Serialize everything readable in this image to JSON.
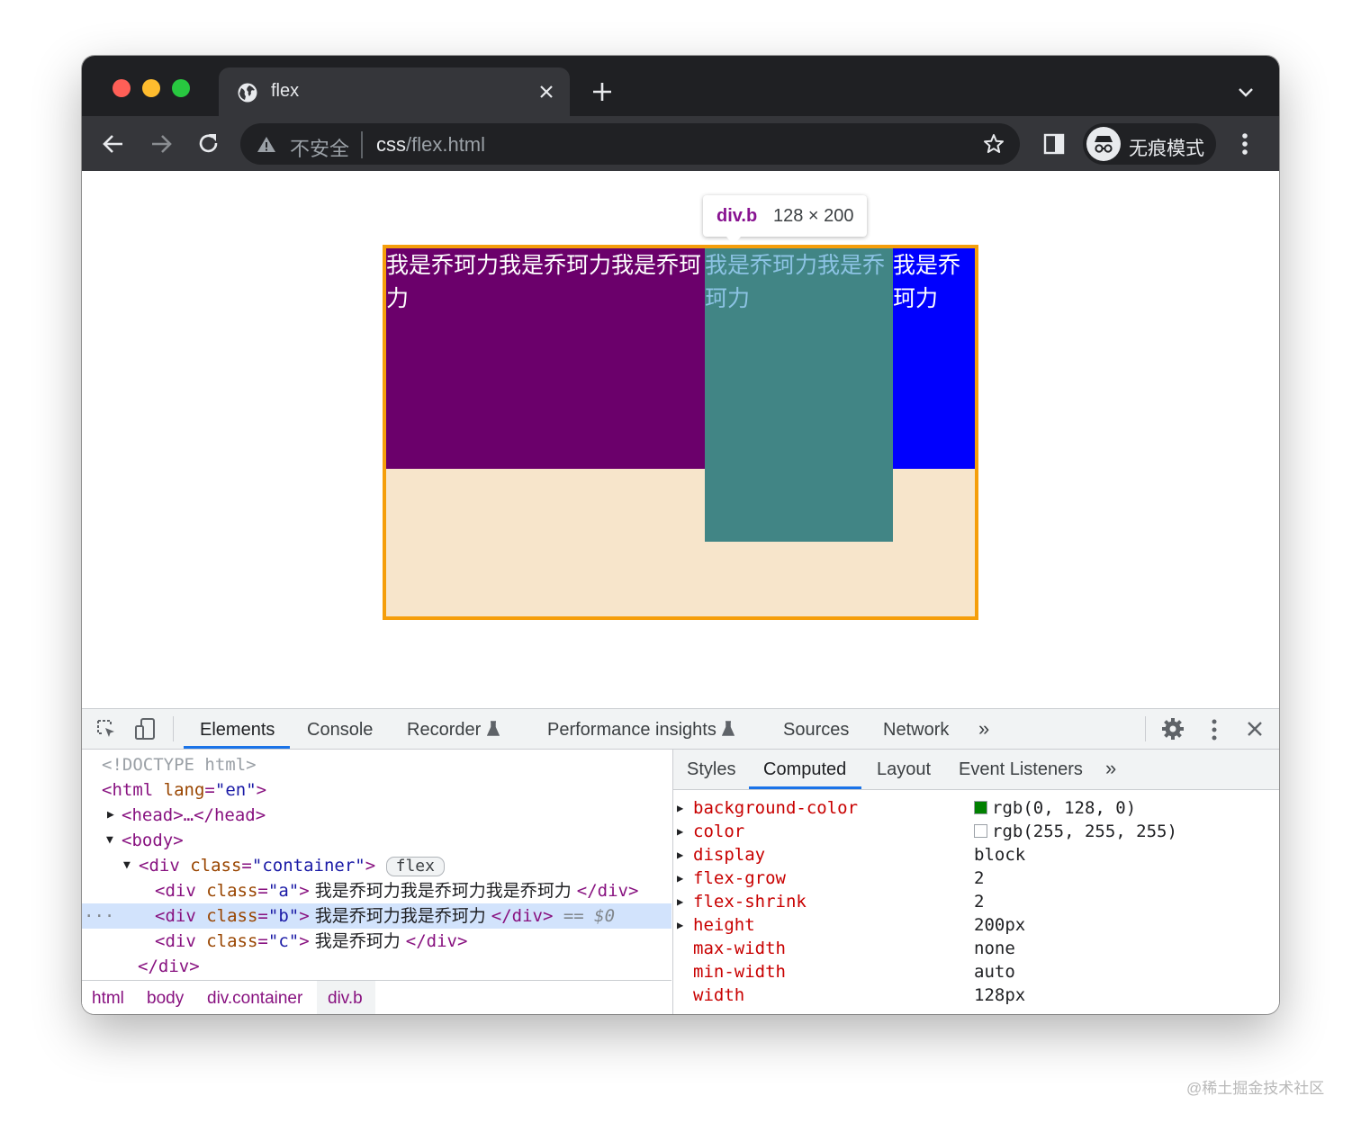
{
  "colors": {
    "container_border": "#f59e0b",
    "container_bg": "#f7e5cb",
    "box_a": "#6b006b",
    "box_b": "#418585",
    "box_c": "#0000fe",
    "active_tab_underline": "#1a73e8"
  },
  "browser": {
    "tab_title": "flex",
    "tab_icon": "globe-icon",
    "security_label": "不安全",
    "url_host": "css",
    "url_path": "/flex.html",
    "incognito_label": "无痕模式"
  },
  "page": {
    "box_a_text": "我是乔珂力我是乔珂力我是乔珂力",
    "box_b_text": "我是乔珂力我是乔珂力",
    "box_c_text": "我是乔珂力",
    "tooltip": {
      "selector": "div.b",
      "size": "128 × 200"
    }
  },
  "devtools": {
    "tabs": [
      "Elements",
      "Console",
      "Recorder",
      "Performance insights",
      "Sources",
      "Network"
    ],
    "active_tab": "Elements",
    "more_tabs": "»",
    "dom": {
      "doctype": "<!DOCTYPE html>",
      "html_open": "<html",
      "html_attr": "lang",
      "html_val": "\"en\"",
      "head": "<head>…</head>",
      "body": "<body>",
      "container_open": "<div",
      "container_attr": "class",
      "container_val": "\"container\"",
      "flex_badge": "flex",
      "div_a_val": "\"a\"",
      "div_a_text": " 我是乔珂力我是乔珂力我是乔珂力 ",
      "div_b_val": "\"b\"",
      "div_b_text": " 我是乔珂力我是乔珂力 ",
      "div_c_val": "\"c\"",
      "div_c_text": " 我是乔珂力 ",
      "div_close": "</div>",
      "dollar_zero": "== $0",
      "ellipsis": "···"
    },
    "breadcrumbs": [
      "html",
      "body",
      "div.container",
      "div.b"
    ],
    "subtabs": [
      "Styles",
      "Computed",
      "Layout",
      "Event Listeners"
    ],
    "active_subtab": "Computed",
    "computed": [
      {
        "name": "background-color",
        "value": "rgb(0, 128, 0)",
        "swatch": "#008000",
        "expandable": true
      },
      {
        "name": "color",
        "value": "rgb(255, 255, 255)",
        "swatch": "#ffffff",
        "expandable": true
      },
      {
        "name": "display",
        "value": "block",
        "expandable": true
      },
      {
        "name": "flex-grow",
        "value": "2",
        "expandable": true
      },
      {
        "name": "flex-shrink",
        "value": "2",
        "expandable": true
      },
      {
        "name": "height",
        "value": "200px",
        "expandable": true
      },
      {
        "name": "max-width",
        "value": "none",
        "expandable": false
      },
      {
        "name": "min-width",
        "value": "auto",
        "expandable": false
      },
      {
        "name": "width",
        "value": "128px",
        "expandable": false
      }
    ]
  },
  "watermark": "@稀土掘金技术社区"
}
